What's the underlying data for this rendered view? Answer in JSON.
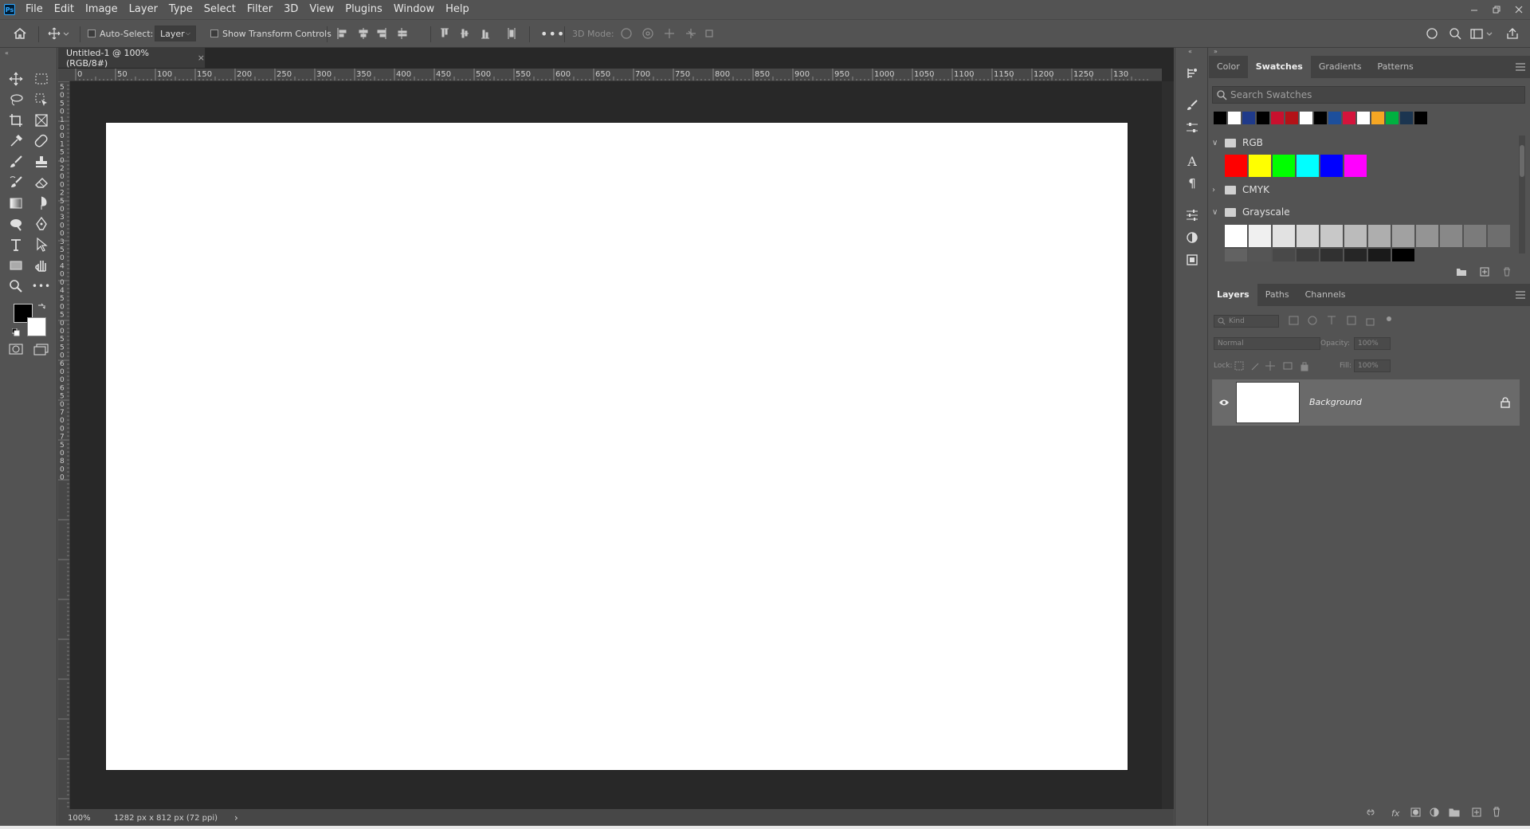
{
  "menubar": {
    "logo": "Ps",
    "items": [
      "File",
      "Edit",
      "Image",
      "Layer",
      "Type",
      "Select",
      "Filter",
      "3D",
      "View",
      "Plugins",
      "Window",
      "Help"
    ]
  },
  "options": {
    "auto_select_label": "Auto-Select:",
    "auto_select_value": "Layer",
    "show_transform_label": "Show Transform Controls",
    "mode_3d_label": "3D Mode:"
  },
  "document": {
    "tab_title": "Untitled-1 @ 100% (RGB/8#)",
    "close_glyph": "×",
    "ruler_h_labels": [
      "0",
      "50",
      "100",
      "150",
      "200",
      "250",
      "300",
      "350",
      "400",
      "450",
      "500",
      "550",
      "600",
      "650",
      "700",
      "750",
      "800",
      "850",
      "900",
      "950",
      "1000",
      "1050",
      "1100",
      "1150",
      "1200",
      "1250",
      "130"
    ],
    "ruler_v_labels": [
      "5",
      "0",
      "5",
      "0",
      "1",
      "0",
      "0",
      "1",
      "5",
      "0",
      "2",
      "0",
      "0",
      "2",
      "5",
      "0",
      "3",
      "0",
      "0",
      "3",
      "5",
      "0",
      "4",
      "0",
      "0",
      "4",
      "5",
      "0",
      "5",
      "0",
      "0",
      "5",
      "5",
      "0",
      "6",
      "0",
      "0",
      "6",
      "5",
      "0",
      "7",
      "0",
      "0",
      "7",
      "5",
      "0",
      "8",
      "0",
      "0"
    ],
    "zoom": "100%",
    "doc_info": "1282 px x 812 px (72 ppi)",
    "status_arrow": "›"
  },
  "swatches_panel": {
    "tabs": [
      "Color",
      "Swatches",
      "Gradients",
      "Patterns"
    ],
    "active_tab": "Swatches",
    "search_placeholder": "Search Swatches",
    "recent_colors": [
      "#000000",
      "#ffffff",
      "#1f3a8a",
      "#000000",
      "#c8102e",
      "#b31217",
      "#ffffff",
      "#000000",
      "#1d4f9c",
      "#d4143c",
      "#ffffff",
      "#f5a623",
      "#00b140",
      "#1b3550",
      "#000000"
    ],
    "groups": [
      {
        "name": "RGB",
        "expanded": true,
        "colors": [
          "#ff0000",
          "#ffff00",
          "#00ff00",
          "#00ffff",
          "#0000ff",
          "#ff00ff"
        ]
      },
      {
        "name": "CMYK",
        "expanded": false
      },
      {
        "name": "Grayscale",
        "expanded": true,
        "colors": [
          "#ffffff",
          "#f0f0f0",
          "#e2e2e2",
          "#d5d5d5",
          "#c8c8c8",
          "#bbbbbb",
          "#aeaeae",
          "#a1a1a1",
          "#949494",
          "#888888",
          "#7b7b7b",
          "#6e6e6e",
          "#626262",
          "#555555",
          "#494949",
          "#3d3d3d",
          "#313131",
          "#262626",
          "#1a1a1a",
          "#000000"
        ]
      }
    ]
  },
  "layers_panel": {
    "tabs": [
      "Layers",
      "Paths",
      "Channels"
    ],
    "active_tab": "Layers",
    "filter_placeholder": "Kind",
    "blend_mode": "Normal",
    "opacity_label": "Opacity:",
    "opacity_value": "100%",
    "lock_label": "Lock:",
    "fill_label": "Fill:",
    "fill_value": "100%",
    "layers": [
      {
        "name": "Background",
        "visible": true,
        "locked": true
      }
    ]
  },
  "colors": {
    "foreground": "#000000",
    "background": "#ffffff",
    "ui_bg": "#535353",
    "pasteboard": "#282828"
  }
}
